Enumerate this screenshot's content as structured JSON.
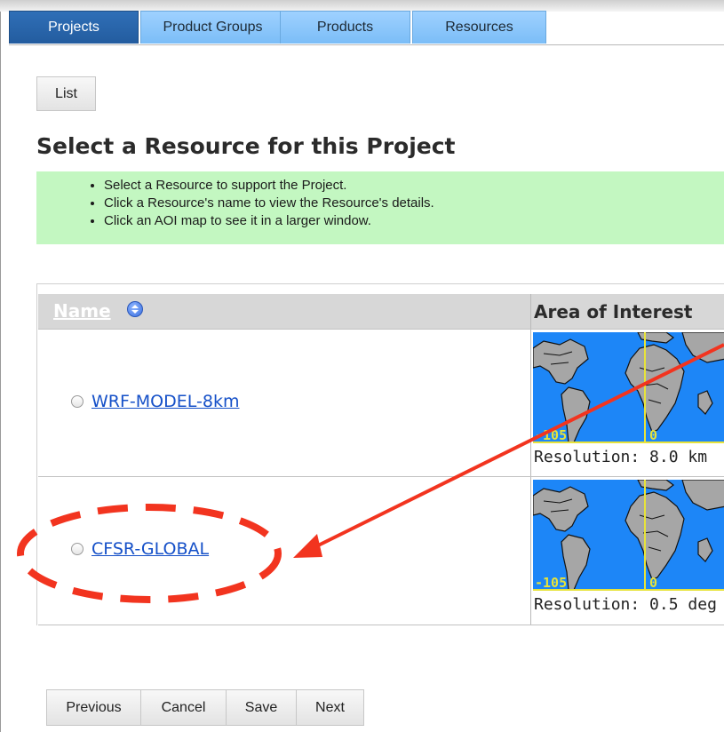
{
  "tabs": [
    {
      "label": "Projects",
      "active": true
    },
    {
      "label": "Product Groups",
      "active": false
    },
    {
      "label": "Products",
      "active": false
    },
    {
      "label": "Resources",
      "active": false
    }
  ],
  "list_button": "List",
  "heading": "Select a Resource for this Project",
  "info_items": [
    "Select a Resource to support the Project.",
    "Click a Resource's name to view the Resource's details.",
    "Click an AOI map to see it in a larger window."
  ],
  "table": {
    "col_name": "Name",
    "col_aoi": "Area of Interest",
    "rows": [
      {
        "name": "WRF-MODEL-8km",
        "lon_left": "-105",
        "lon_mid": "0",
        "resolution": "Resolution: 8.0 km"
      },
      {
        "name": "CFSR-GLOBAL",
        "lon_left": "-105",
        "lon_mid": "0",
        "resolution": "Resolution: 0.5 deg"
      }
    ]
  },
  "buttons": {
    "previous": "Previous",
    "cancel": "Cancel",
    "save": "Save",
    "next": "Next"
  },
  "colors": {
    "annotation": "#f2341f",
    "map_ocean": "#1d86f7",
    "map_land": "#a6a6a6",
    "map_lines": "#e7e33a"
  }
}
